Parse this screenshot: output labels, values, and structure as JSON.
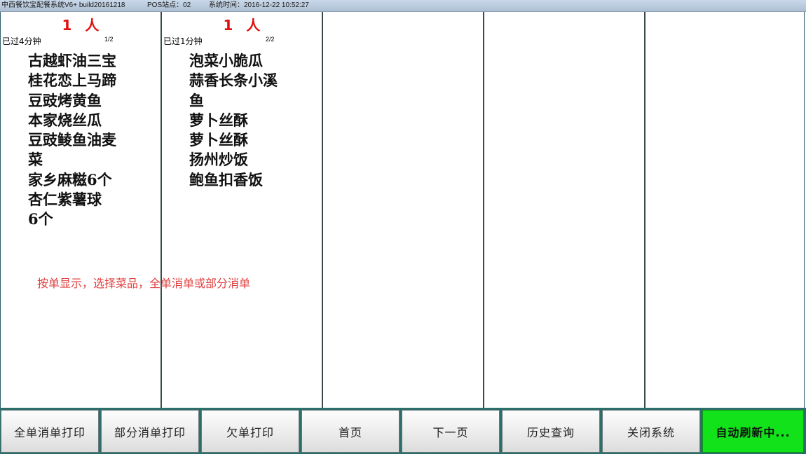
{
  "titlebar": {
    "app_name": "中西餐饮宝配餐系统V6+ build20161218",
    "pos_station": "POS站点：02",
    "system_time": "系统时间：2016-12-22 10:52:27"
  },
  "orders": [
    {
      "persons": "1 人",
      "elapsed": "已过4分钟",
      "page": "1/2",
      "dishes": [
        "古越虾油三宝",
        "桂花恋上马蹄",
        "豆豉烤黄鱼",
        "本家烧丝瓜",
        "豆豉鲮鱼油麦",
        "菜",
        "家乡麻糍6个",
        "杏仁紫薯球",
        "6个"
      ]
    },
    {
      "persons": "1 人",
      "elapsed": "已过1分钟",
      "page": "2/2",
      "dishes": [
        "泡菜小脆瓜",
        "蒜香长条小溪",
        "鱼",
        "萝卜丝酥",
        "萝卜丝酥",
        "扬州炒饭",
        "鲍鱼扣香饭"
      ]
    }
  ],
  "hint": "按单显示，选择菜品，全单消单或部分消单",
  "toolbar": {
    "full_clear_print": "全单消单打印",
    "partial_clear_print": "部分消单打印",
    "owed_print": "欠单打印",
    "first_page": "首页",
    "next_page": "下一页",
    "history_query": "历史查询",
    "close_system": "关闭系统",
    "auto_refresh": "自动刷新中..."
  },
  "colors": {
    "person_count": "#e01010",
    "hint": "#e04040",
    "toolbar_bg": "#2e6e6a",
    "refresh_button": "#11e21a"
  }
}
